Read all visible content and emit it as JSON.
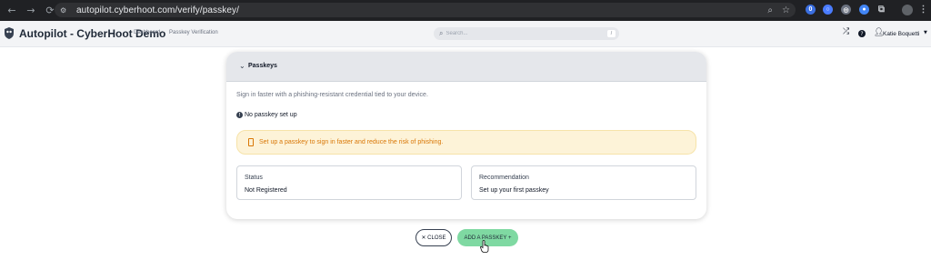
{
  "browser": {
    "url": "autopilot.cyberhoot.com/verify/passkey/",
    "nav": {
      "back": "←",
      "forward": "→",
      "reload": "⟳"
    },
    "icons": [
      "zoom-icon",
      "bookmark-star-icon"
    ],
    "extensions": [
      {
        "name": "extension-1password-icon",
        "glyph": "0",
        "color": "#3b6fe0"
      },
      {
        "name": "extension-blue-icon",
        "glyph": "○",
        "color": "#4a7cff"
      },
      {
        "name": "extension-grey-icon",
        "glyph": "◎",
        "color": "#6b7280"
      },
      {
        "name": "extension-colorful-icon",
        "glyph": "●",
        "color": "#4285f4"
      }
    ]
  },
  "header": {
    "title": "Autopilot - CyberHoot Demo",
    "breadcrumb": [
      "Dashboard",
      "Passkey Verification"
    ],
    "breadcrumb_separator": "›",
    "search": {
      "placeholder": "Search...",
      "shortcut": "/"
    },
    "user": {
      "name": "Katie Boquetti"
    }
  },
  "card": {
    "title": "Passkeys",
    "description": "Sign in faster with a phishing-resistant credential tied to your device.",
    "status_line": "No passkey set up",
    "alert": {
      "text": "Set up a passkey to sign in faster and reduce the risk of phishing.",
      "color": "#d97706",
      "background": "#fdf3d8"
    },
    "boxes": [
      {
        "label": "Status",
        "value": "Not Registered"
      },
      {
        "label": "Recommendation",
        "value": "Set up your first passkey"
      }
    ]
  },
  "actions": {
    "close_label": "✕ CLOSE",
    "add_label": "ADD A PASSKEY +",
    "add_color": "#7fd9a2"
  }
}
